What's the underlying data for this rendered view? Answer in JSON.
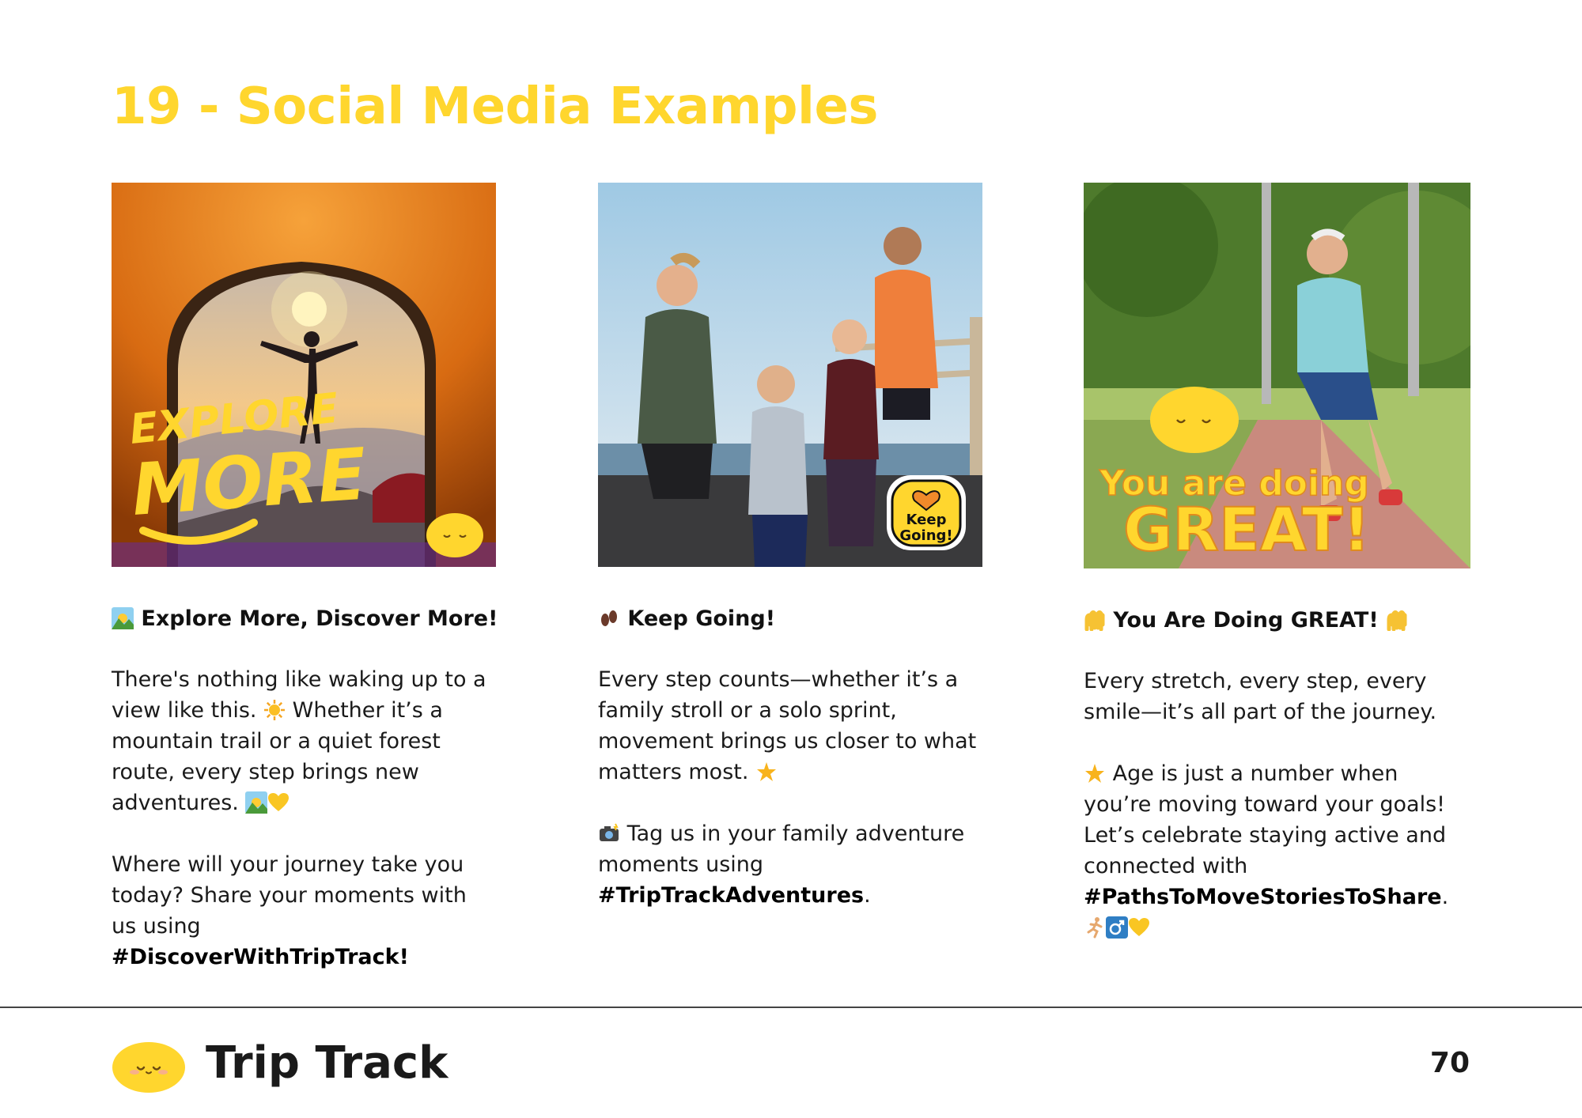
{
  "page": {
    "title": "19 - Social Media Examples",
    "page_number": "70"
  },
  "brand": {
    "name": "Trip Track",
    "accent_color": "#FFD62E"
  },
  "posts": [
    {
      "image_overlay_text": [
        "EXPLORE",
        "MORE"
      ],
      "heading": "Explore More, Discover More!",
      "heading_icon": "sunrise-over-mountains-icon",
      "body_1": "There's nothing like waking up to a view like this.",
      "body_1_icon": "sun-icon",
      "body_1b": "Whether it’s a mountain trail or a quiet forest route, every step brings new adventures.",
      "body_1b_icons": [
        "sunrise-over-mountains-icon",
        "yellow-heart-icon"
      ],
      "body_2": "Where will your journey take you today? Share your moments with us using",
      "hashtag": "#DiscoverWithTripTrack!"
    },
    {
      "image_overlay_text": [
        "Keep",
        "Going!"
      ],
      "heading": "Keep Going!",
      "heading_icon": "footprints-icon",
      "body_1": "Every step counts—whether it’s a family stroll or a solo sprint, movement brings us closer to what matters most.",
      "body_1_icon": "glowing-star-icon",
      "body_2_icon": "camera-flash-icon",
      "body_2": "Tag us in your family adventure moments using",
      "hashtag": "#TripTrackAdventures",
      "hashtag_suffix": "."
    },
    {
      "image_overlay_text": [
        "You are doing",
        "GREAT!"
      ],
      "heading": "You Are Doing GREAT!",
      "heading_icons": [
        "raising-hands-icon",
        "raising-hands-icon"
      ],
      "body_1": "Every stretch, every step, every smile—it’s all part of the journey.",
      "body_2_icon": "glowing-star-icon",
      "body_2": "Age is just a number when you’re moving toward your goals! Let’s celebrate staying active and connected with",
      "hashtag": "#PathsToMoveStoriesToShare",
      "hashtag_suffix": ".",
      "trailing_icons": [
        "man-running-icon",
        "male-sign-icon",
        "yellow-heart-icon"
      ]
    }
  ]
}
